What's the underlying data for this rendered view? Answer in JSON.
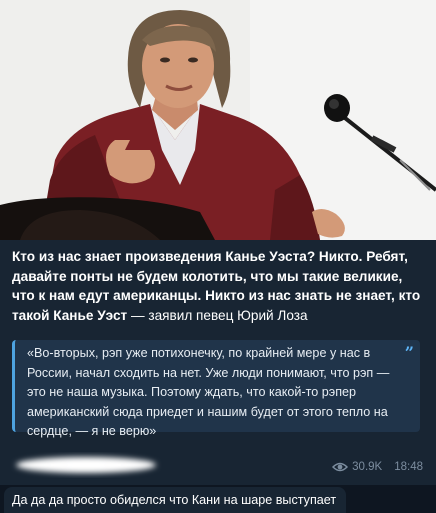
{
  "post": {
    "headline": "Кто из нас знает произведения Канье Уэста? Никто. Ребят, давайте понты не будем колотить, что мы такие великие, что к нам едут американцы. Никто из нас знать не знает, кто такой Канье Уэст",
    "attribution": " — заявил певец Юрий Лоза",
    "quote": "«Во-вторых, рэп уже потихонечку, по крайней мере у нас в России, начал сходить на нет. Уже люди понимают, что рэп — это не наша музыка. Поэтому ждать, что какой-то рэпер американский сюда приедет и нашим будет от этого тепло на сердце, — я не верю»",
    "quote_mark": "”",
    "views": "30.9K",
    "time": "18:48"
  },
  "comment": {
    "text": "Да да да просто обиделся что Кани на шаре выступает"
  },
  "icons": {
    "views": "eye-icon"
  },
  "colors": {
    "background": "#0e1621",
    "bubble": "#182533",
    "quote_bg": "#20344a",
    "quote_accent": "#4ea3e0",
    "meta": "#7c8d9f"
  }
}
